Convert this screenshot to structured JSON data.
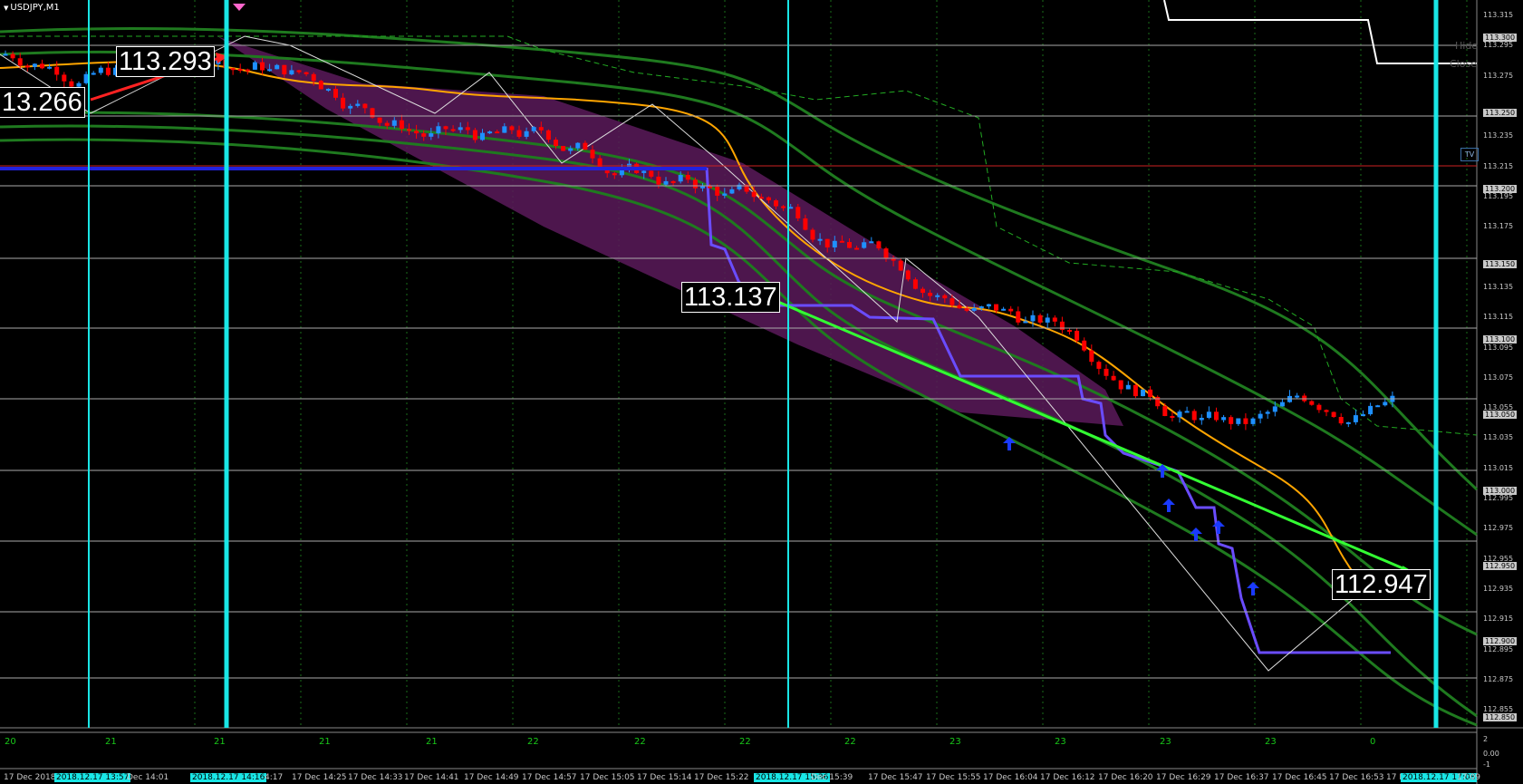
{
  "symbol": "USDJPY,M1",
  "price_axis": [
    "113.315",
    "113.300",
    "113.295",
    "113.275",
    "113.250",
    "113.235",
    "113.215",
    "113.200",
    "113.195",
    "113.175",
    "113.150",
    "113.135",
    "113.115",
    "113.100",
    "113.095",
    "113.075",
    "113.055",
    "113.050",
    "113.035",
    "113.015",
    "113.000",
    "112.995",
    "112.975",
    "112.955",
    "112.950",
    "112.935",
    "112.915",
    "112.900",
    "112.895",
    "112.875",
    "112.855",
    "112.850"
  ],
  "time_axis": [
    "17 Dec 2018",
    "2018.12.17 13:57",
    "Dec 14:01",
    "2018.12.17 14:16",
    "4:17",
    "17 Dec 14:25",
    "17 Dec 14:33",
    "17 Dec 14:41",
    "17 Dec 14:49",
    "17 Dec 14:57",
    "17 Dec 15:05",
    "17 Dec 15:14",
    "17 Dec 15:22",
    "2018.12.17 15:36",
    "Dec 15:39",
    "17 Dec 15:47",
    "17 Dec 15:55",
    "17 Dec 16:04",
    "17 Dec 16:12",
    "17 Dec 16:20",
    "17 Dec 16:29",
    "17 Dec 16:37",
    "17 Dec 16:45",
    "17 Dec 16:53",
    "17 D",
    "2018.12.17 17:08",
    "17:09"
  ],
  "day_labels": [
    "20",
    "21",
    "21",
    "21",
    "21",
    "22",
    "22",
    "22",
    "22",
    "23",
    "23",
    "23",
    "23",
    "0"
  ],
  "price_tags": [
    "13.266",
    "113.293",
    "113.137",
    "112.947"
  ],
  "side_buttons": [
    "Hide",
    "Close"
  ],
  "badge": "TV",
  "subwindow_axis": [
    "2",
    "0.00",
    "-1"
  ],
  "colors": {
    "background": "#000000",
    "bull": "#1e90ff",
    "bear": "#ff0000",
    "ma": "#ffa500",
    "band": "#1f7a1f",
    "channel": "#5a1a5a",
    "trend": "#33ff33",
    "vline": "#19e6e6",
    "hline_blue": "#2222dd",
    "support": "#6a4cff"
  }
}
